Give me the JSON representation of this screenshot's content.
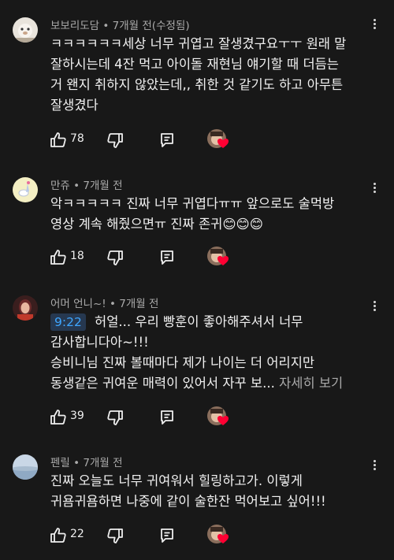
{
  "comments": [
    {
      "author": "보보리도담",
      "time": "7개월 전(수정됨)",
      "lines": [
        "ㅋㅋㅋㅋㅋㅋ세상 너무 귀엽고 잘생겼구요ㅜㅜ 원래 말",
        "잘하시는데 4잔 먹고 아이돌 재현님 얘기할 때 더듬는",
        "거 왠지 취하지 않았는데,, 취한 것 같기도 하고 아무튼",
        "잘생겼다"
      ],
      "likes": "78"
    },
    {
      "author": "만쥬",
      "time": "7개월 전",
      "lines": [
        "악ㅋㅋㅋㅋㅋ 진짜 너무 귀엽다ㅠㅠ 앞으로도 술먹방",
        "영상 계속 해줬으면ㅠ 진짜 존귀😊😊😊"
      ],
      "likes": "18"
    },
    {
      "author": "어머 언니~!",
      "time": "7개월 전",
      "timestamp_link": "9:22",
      "lines": [
        " 허얼... 우리 빵훈이 좋아해주셔서 너무",
        "감사합니다아~!!!",
        "승비니님 진짜 볼때마다 제가 나이는 더 어리지만",
        "동생같은 귀여운 매력이 있어서 자꾸 보..."
      ],
      "read_more": "자세히 보기",
      "likes": "39"
    },
    {
      "author": "펜릴",
      "time": "7개월 전",
      "lines": [
        "진짜 오늘도 너무 귀여워서 힐링하고가. 이렇게",
        "귀욤귀욤하면 나중에 같이 술한잔 먹어보고 싶어!!!"
      ],
      "likes": "22"
    }
  ],
  "meta_separator": " • ",
  "icons": [
    "thumbs-up-icon",
    "thumbs-down-icon",
    "reply-icon",
    "creator-heart-icon",
    "more-vert-icon"
  ],
  "colors": {
    "background": "#181818",
    "text": "#f1f1f1",
    "secondary": "#aaaaaa",
    "link": "#3ea6ff",
    "heart": "#ff0033"
  }
}
